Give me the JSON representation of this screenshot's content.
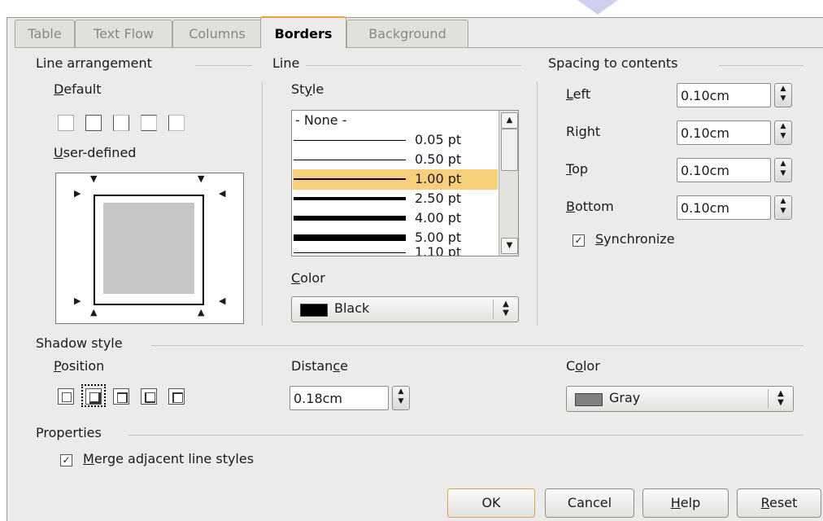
{
  "tabs": [
    {
      "label": "Table"
    },
    {
      "label": "Text Flow"
    },
    {
      "label": "Columns"
    },
    {
      "label": "Borders"
    },
    {
      "label": "Background"
    }
  ],
  "line_arrangement": {
    "title": "Line arrangement",
    "default_label": "Default",
    "user_defined_label": "User-defined"
  },
  "line": {
    "title": "Line",
    "style_label": "Style",
    "styles": [
      "- None -",
      "0.05 pt",
      "0.50 pt",
      "1.00 pt",
      "2.50 pt",
      "4.00 pt",
      "5.00 pt",
      "1.10 pt"
    ],
    "selected_style": "1.00 pt",
    "color_label": "Color",
    "color_value": "Black",
    "color_swatch": "#000000"
  },
  "spacing": {
    "title": "Spacing to contents",
    "left_label": "Left",
    "left_value": "0.10cm",
    "right_label": "Right",
    "right_value": "0.10cm",
    "top_label": "Top",
    "top_value": "0.10cm",
    "bottom_label": "Bottom",
    "bottom_value": "0.10cm",
    "synchronize_label": "Synchronize",
    "synchronize_checked": true
  },
  "shadow": {
    "title": "Shadow style",
    "position_label": "Position",
    "distance_label": "Distance",
    "distance_value": "0.18cm",
    "color_label": "Color",
    "color_value": "Gray",
    "color_swatch": "#808080"
  },
  "properties": {
    "title": "Properties",
    "merge_label": "Merge adjacent line styles",
    "merge_checked": true
  },
  "buttons": {
    "ok": "OK",
    "cancel": "Cancel",
    "help": "Help",
    "reset": "Reset"
  },
  "colors": {
    "selection": "#f6cf7c",
    "active_tab_accent": "#e8a43a"
  }
}
